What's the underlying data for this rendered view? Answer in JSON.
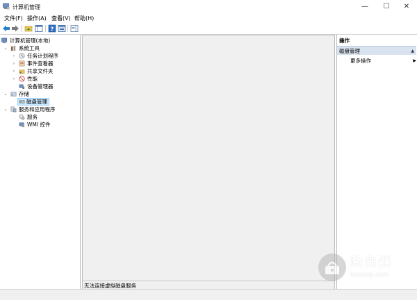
{
  "window": {
    "title": "计算机管理",
    "minimize_glyph": "—",
    "maximize_glyph": "☐",
    "close_glyph": "✕"
  },
  "menu": [
    "文件(F)",
    "操作(A)",
    "查看(V)",
    "帮助(H)"
  ],
  "toolbar": {
    "icons": [
      "back-icon",
      "forward-icon",
      "up-folder-icon",
      "show-hide-tree-icon",
      "help-icon",
      "properties-icon",
      "show-action-pane-icon"
    ]
  },
  "tree": {
    "root": "计算机管理(本地)",
    "system_tools": "系统工具",
    "task_scheduler": "任务计划程序",
    "event_viewer": "事件查看器",
    "shared_folders": "共享文件夹",
    "performance": "性能",
    "device_manager": "设备管理器",
    "storage": "存储",
    "disk_management": "磁盘管理",
    "services_apps": "服务和应用程序",
    "services": "服务",
    "wmi": "WMI 控件"
  },
  "status": {
    "text": "无法连接虚拟磁盘服务"
  },
  "actions": {
    "header": "操作",
    "section": "磁盘管理",
    "more": "更多操作"
  },
  "watermark": {
    "title": "路由器",
    "subtitle": "luyouqi.com"
  },
  "colors": {
    "selected_bg": "#cce8ff",
    "action_section_bg": "#d9e3ef",
    "pane_bg": "#f0f0f0"
  }
}
